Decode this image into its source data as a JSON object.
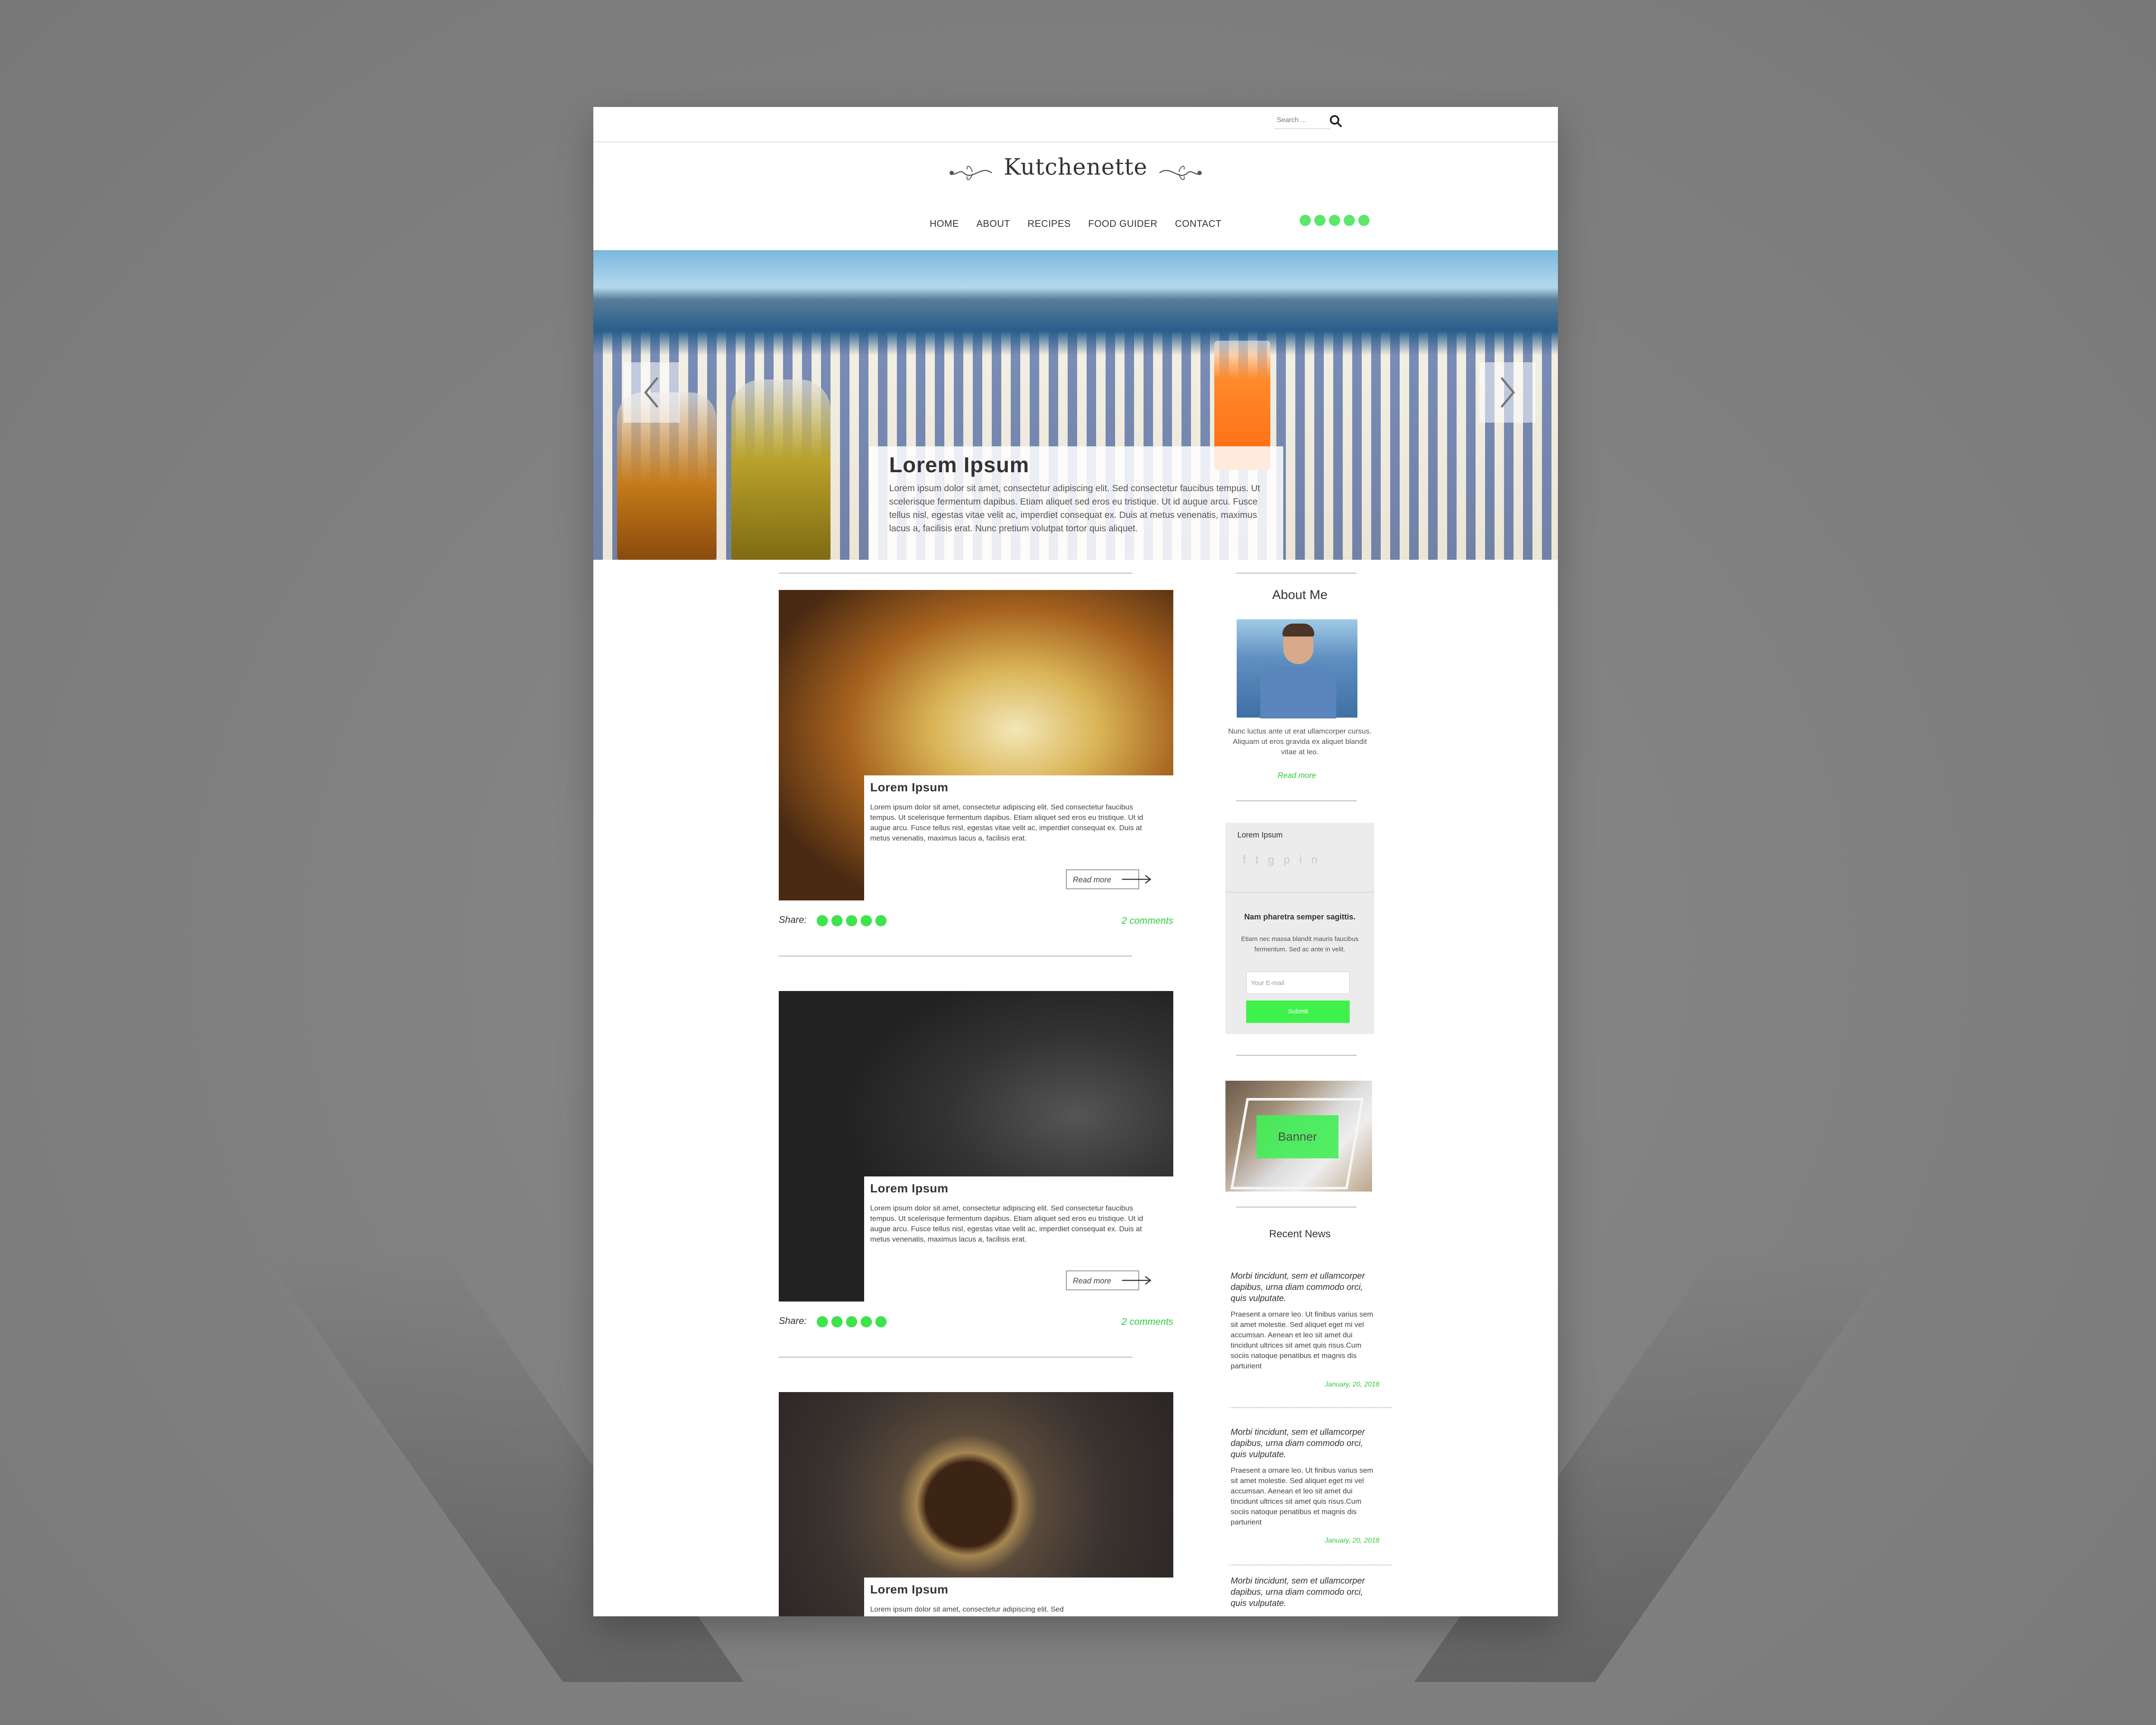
{
  "search": {
    "placeholder": "Search ..."
  },
  "logo": {
    "text": "Kutchenette"
  },
  "nav": {
    "items": [
      "HOME",
      "ABOUT",
      "RECIPES",
      "FOOD GUIDER",
      "CONTACT"
    ]
  },
  "hero": {
    "title": "Lorem Ipsum",
    "text": "Lorem ipsum dolor sit amet, consectetur adipiscing elit. Sed consectetur faucibus tempus. Ut scelerisque fermentum dapibus. Etiam aliquet sed eros eu tristique. Ut id augue arcu. Fusce tellus nisl, egestas vitae velit ac, imperdiet consequat ex. Duis at metus venenatis, maximus lacus a, facilisis erat. Nunc pretium volutpat tortor quis aliquet."
  },
  "posts": [
    {
      "title": "Lorem Ipsum",
      "text": "Lorem ipsum dolor sit amet, consectetur adipiscing elit. Sed consectetur faucibus tempus. Ut scelerisque fermentum dapibus. Etiam aliquet sed eros eu tristique. Ut id augue arcu. Fusce tellus nisl, egestas vitae velit ac, imperdiet consequat ex. Duis at metus venenatis, maximus lacus a, facilisis erat.",
      "read_more": "Read more",
      "share_label": "Share:",
      "comments": "2 comments"
    },
    {
      "title": "Lorem Ipsum",
      "text": "Lorem ipsum dolor sit amet, consectetur adipiscing elit. Sed consectetur faucibus tempus. Ut scelerisque fermentum dapibus. Etiam aliquet sed eros eu tristique. Ut id augue arcu. Fusce tellus nisl, egestas vitae velit ac, imperdiet consequat ex. Duis at metus venenatis, maximus lacus a, facilisis erat.",
      "read_more": "Read more",
      "share_label": "Share:",
      "comments": "2 comments"
    },
    {
      "title": "Lorem Ipsum",
      "text": "Lorem ipsum dolor sit amet, consectetur adipiscing elit. Sed"
    }
  ],
  "sidebar": {
    "about_title": "About Me",
    "about_text": "Nunc luctus ante ut erat ullamcorper cursus. Aliquam ut eros gravida ex aliquet blandit vitae at leo.",
    "about_read_more": "Read more",
    "subscribe": {
      "title": "Lorem Ipsum",
      "heading": "Nam pharetra semper sagittis.",
      "text": "Etiam nec massa blandit mauris faucibus fermentum. Sed ac ante in velit.",
      "email_placeholder": "Your E-mail",
      "submit_label": "Submit"
    },
    "banner_label": "Banner",
    "recent_news_title": "Recent News",
    "news": [
      {
        "title": "Morbi tincidunt, sem et ullamcorper dapibus, urna diam commodo orci, quis vulputate.",
        "body": "Praesent a ornare leo. Ut finibus varius sem sit amet molestie. Sed aliquet eget mi vel accumsan. Aenean et leo sit amet dui tincidunt ultrices sit amet quis risus.Cum sociis natoque penatibus et magnis dis parturient",
        "date": "January, 20, 2018"
      },
      {
        "title": "Morbi tincidunt, sem et ullamcorper dapibus, urna diam commodo orci, quis vulputate.",
        "body": "Praesent a ornare leo. Ut finibus varius sem sit amet molestie. Sed aliquet eget mi vel accumsan. Aenean et leo sit amet dui tincidunt ultrices sit amet quis risus.Cum sociis natoque penatibus et magnis dis parturient",
        "date": "January, 20, 2018"
      },
      {
        "title": "Morbi tincidunt, sem et ullamcorper dapibus, urna diam commodo orci, quis vulputate."
      }
    ]
  },
  "colors": {
    "accent_green": "#3ff24b",
    "link_green": "#2ecb3a"
  },
  "icons": {
    "social": [
      "facebook-icon",
      "twitter-icon",
      "google-plus-icon",
      "pinterest-icon",
      "linkedin-icon"
    ]
  }
}
